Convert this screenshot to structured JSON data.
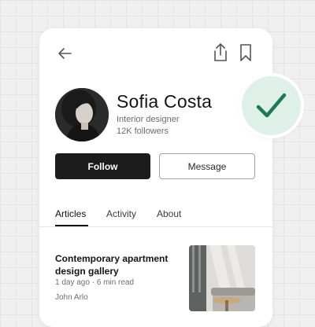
{
  "profile": {
    "name": "Sofia Costa",
    "role": "Interior designer",
    "followers": "12K followers"
  },
  "actions": {
    "follow_label": "Follow",
    "message_label": "Message"
  },
  "tabs": [
    {
      "label": "Articles",
      "active": true
    },
    {
      "label": "Activity",
      "active": false
    },
    {
      "label": "About",
      "active": false
    }
  ],
  "article": {
    "title": "Contemporary apartment design gallery",
    "meta": "1 day ago · 6 min read",
    "author": "John Arlo"
  },
  "icons": {
    "back": "arrow-left-icon",
    "share": "share-icon",
    "bookmark": "bookmark-icon",
    "badge": "checkmark-icon"
  },
  "colors": {
    "primary_button": "#1c1c1c",
    "badge_background": "#dff0e8",
    "badge_check": "#1e7a52"
  }
}
